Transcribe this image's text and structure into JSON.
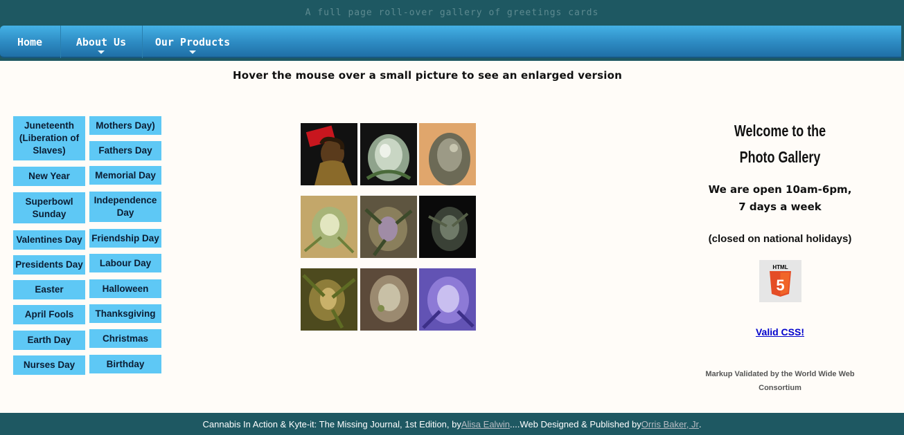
{
  "site": {
    "title": "A full page roll-over gallery of greetings cards"
  },
  "nav": {
    "home": "Home",
    "about": "About Us",
    "products": "Our Products"
  },
  "instruction": "Hover the mouse over a small picture to see an enlarged version",
  "holidays": {
    "left": [
      "Juneteenth (Liberation of Slaves)",
      "New Year",
      "Superbowl Sunday",
      "Valentines Day",
      "Presidents Day",
      "Easter",
      "April Fools",
      "Earth Day",
      "Nurses Day"
    ],
    "right": [
      "Mothers Day)",
      "Fathers Day",
      "Memorial Day",
      "Independence Day",
      "Friendship Day",
      "Labour Day",
      "Halloween",
      "Thanksgiving",
      "Christmas",
      "Birthday"
    ]
  },
  "gallery": {
    "thumbnails": [
      "person-with-red-sign-photo",
      "frosty-bud-photo",
      "orange-hair-bud-photo",
      "golden-bud-photo",
      "purple-leaf-bud-photo",
      "dark-leaf-bud-photo",
      "green-leaf-bud-photo",
      "trichome-bud-photo",
      "purple-glow-bud-photo"
    ]
  },
  "sidebar": {
    "welcome": "Welcome to the Photo Gallery",
    "hours_line1": "We are open 10am-6pm,",
    "hours_line2": "7 days a week",
    "closed": "(closed on national holidays)",
    "badge_label": "HTML",
    "badge_number": "5",
    "valid_css": "Valid CSS!",
    "markup_validated": "Markup Validated by the World Wide Web Consortium"
  },
  "footer": {
    "text_before": "Cannabis In Action & Kyte-it: The Missing Journal, 1st Edition, by ",
    "author": "Alisa Ealwin",
    "text_middle": "....Web Designed & Published by ",
    "designer": "Orris Baker, Jr",
    "text_end": "."
  },
  "colors": {
    "header_bg": "#1e5862",
    "nav_blue": "#2d8ac2",
    "button_blue": "#5ec8f5",
    "page_bg": "#fffcf8",
    "link_blue": "#0000cc",
    "html5_orange": "#e44d26"
  }
}
